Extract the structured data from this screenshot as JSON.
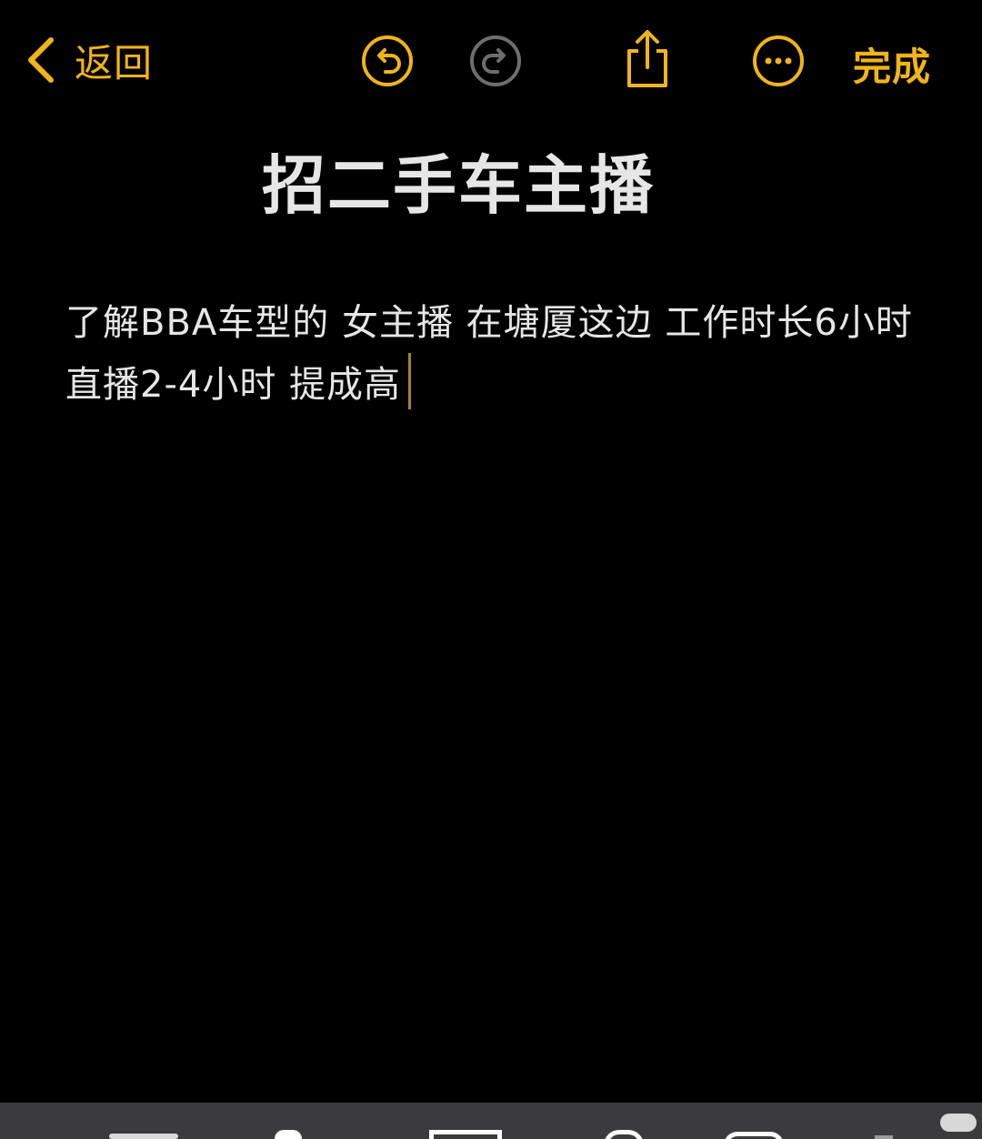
{
  "colors": {
    "accent": "#f2b418",
    "background": "#000000",
    "text": "#e6e6e6",
    "disabled_icon": "#6e6e6e",
    "bottom_bar": "#3b3b3d"
  },
  "toolbar": {
    "back_label": "返回",
    "back_icon": "chevron-left-icon",
    "undo_icon": "undo-icon",
    "redo_icon": "redo-icon",
    "share_icon": "share-icon",
    "more_icon": "more-icon",
    "done_label": "完成"
  },
  "note": {
    "title": "招二手车主播",
    "body": "了解BBA车型的 女主播 在塘厦这边  工作时长6小时 直播2-4小时  提成高"
  },
  "bottom_bar": {
    "icons": [
      "format-icon",
      "checklist-icon",
      "table-icon",
      "attachment-icon",
      "markup-icon",
      "compose-icon"
    ]
  }
}
